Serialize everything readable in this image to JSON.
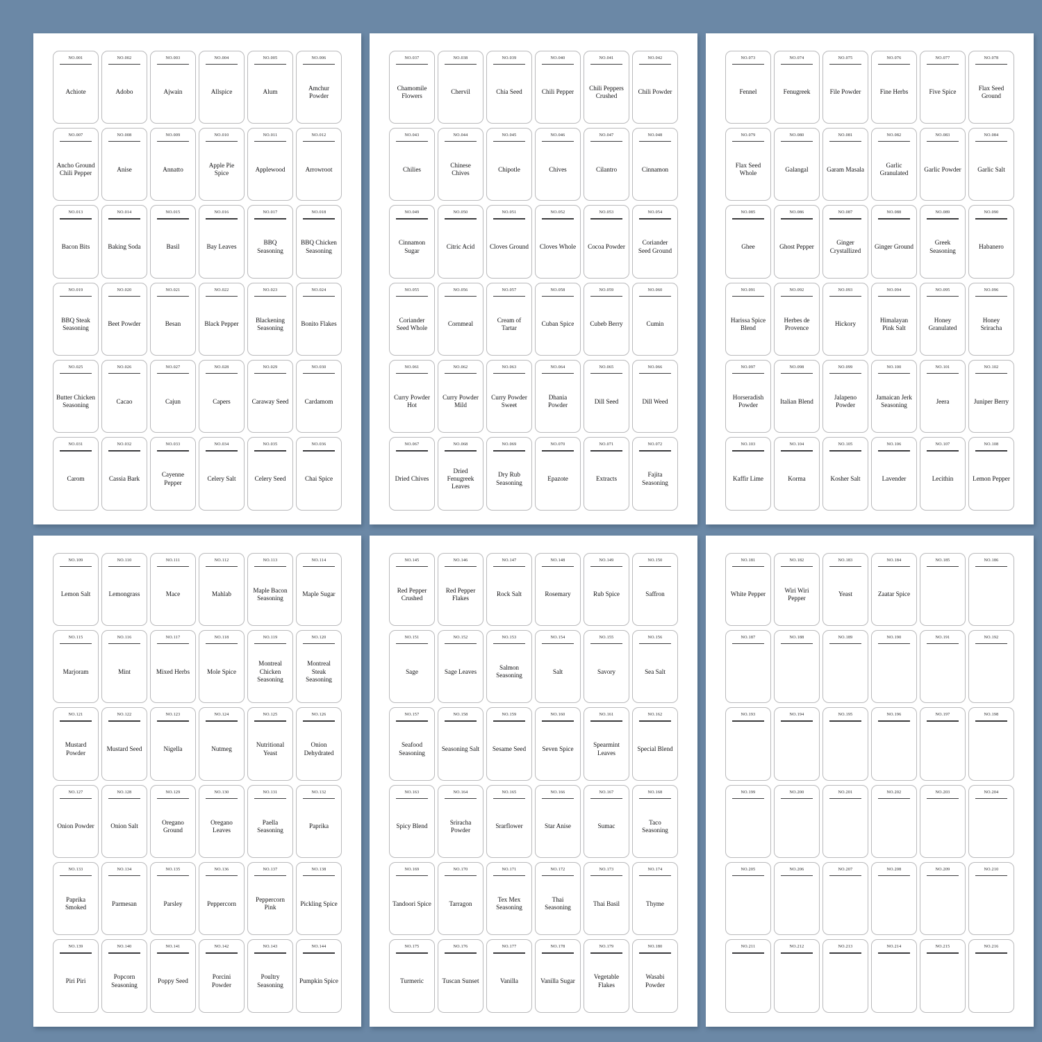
{
  "page": {
    "background_color": "#6b88a6",
    "sheet_color": "#ffffff",
    "card_border_color": "#b9b9bb",
    "rule_color": "#3a3a3c",
    "text_color": "#111113",
    "number_prefix": "NO.",
    "sheets_across": 3,
    "sheets_down": 2,
    "cards_per_sheet": 36,
    "cards_across": 6,
    "cards_down": 6,
    "total_cards": 216
  },
  "sheets": [
    {
      "id": "sheet-1",
      "cards": [
        {
          "no": "NO.001",
          "name": "Achiote"
        },
        {
          "no": "NO.002",
          "name": "Adobo"
        },
        {
          "no": "NO.003",
          "name": "Ajwain"
        },
        {
          "no": "NO.004",
          "name": "Allspice"
        },
        {
          "no": "NO.005",
          "name": "Alum"
        },
        {
          "no": "NO.006",
          "name": "Amchur Powder"
        },
        {
          "no": "NO.007",
          "name": "Ancho Ground Chili Pepper"
        },
        {
          "no": "NO.008",
          "name": "Anise"
        },
        {
          "no": "NO.009",
          "name": "Annatto"
        },
        {
          "no": "NO.010",
          "name": "Apple Pie Spice"
        },
        {
          "no": "NO.011",
          "name": "Applewood"
        },
        {
          "no": "NO.012",
          "name": "Arrowroot"
        },
        {
          "no": "NO.013",
          "name": "Bacon Bits"
        },
        {
          "no": "NO.014",
          "name": "Baking Soda"
        },
        {
          "no": "NO.015",
          "name": "Basil"
        },
        {
          "no": "NO.016",
          "name": "Bay Leaves"
        },
        {
          "no": "NO.017",
          "name": "BBQ Seasoning"
        },
        {
          "no": "NO.018",
          "name": "BBQ Chicken Seasoning"
        },
        {
          "no": "NO.019",
          "name": "BBQ Steak Seasoning"
        },
        {
          "no": "NO.020",
          "name": "Beet Powder"
        },
        {
          "no": "NO.021",
          "name": "Besan"
        },
        {
          "no": "NO.022",
          "name": "Black Pepper"
        },
        {
          "no": "NO.023",
          "name": "Blackening Seasoning"
        },
        {
          "no": "NO.024",
          "name": "Bonito Flakes"
        },
        {
          "no": "NO.025",
          "name": "Butter Chicken Seasoning"
        },
        {
          "no": "NO.026",
          "name": "Cacao"
        },
        {
          "no": "NO.027",
          "name": "Cajun"
        },
        {
          "no": "NO.028",
          "name": "Capers"
        },
        {
          "no": "NO.029",
          "name": "Caraway Seed"
        },
        {
          "no": "NO.030",
          "name": "Cardamom"
        },
        {
          "no": "NO.031",
          "name": "Carom"
        },
        {
          "no": "NO.032",
          "name": "Cassia Bark"
        },
        {
          "no": "NO.033",
          "name": "Cayenne Pepper"
        },
        {
          "no": "NO.034",
          "name": "Celery Salt"
        },
        {
          "no": "NO.035",
          "name": "Celery Seed"
        },
        {
          "no": "NO.036",
          "name": "Chai Spice"
        }
      ]
    },
    {
      "id": "sheet-2",
      "cards": [
        {
          "no": "NO.037",
          "name": "Chamomile Flowers"
        },
        {
          "no": "NO.038",
          "name": "Chervil"
        },
        {
          "no": "NO.039",
          "name": "Chia Seed"
        },
        {
          "no": "NO.040",
          "name": "Chili Pepper"
        },
        {
          "no": "NO.041",
          "name": "Chili Peppers Crushed"
        },
        {
          "no": "NO.042",
          "name": "Chili Powder"
        },
        {
          "no": "NO.043",
          "name": "Chilies"
        },
        {
          "no": "NO.044",
          "name": "Chinese Chives"
        },
        {
          "no": "NO.045",
          "name": "Chipotle"
        },
        {
          "no": "NO.046",
          "name": "Chives"
        },
        {
          "no": "NO.047",
          "name": "Cilantro"
        },
        {
          "no": "NO.048",
          "name": "Cinnamon"
        },
        {
          "no": "NO.049",
          "name": "Cinnamon Sugar"
        },
        {
          "no": "NO.050",
          "name": "Citric Acid"
        },
        {
          "no": "NO.051",
          "name": "Cloves Ground"
        },
        {
          "no": "NO.052",
          "name": "Cloves Whole"
        },
        {
          "no": "NO.053",
          "name": "Cocoa Powder"
        },
        {
          "no": "NO.054",
          "name": "Coriander Seed Ground"
        },
        {
          "no": "NO.055",
          "name": "Coriander Seed Whole"
        },
        {
          "no": "NO.056",
          "name": "Cornmeal"
        },
        {
          "no": "NO.057",
          "name": "Cream of Tartar"
        },
        {
          "no": "NO.058",
          "name": "Cuban Spice"
        },
        {
          "no": "NO.059",
          "name": "Cubeb Berry"
        },
        {
          "no": "NO.060",
          "name": "Cumin"
        },
        {
          "no": "NO.061",
          "name": "Curry Powder Hot"
        },
        {
          "no": "NO.062",
          "name": "Curry Powder Mild"
        },
        {
          "no": "NO.063",
          "name": "Curry Powder Sweet"
        },
        {
          "no": "NO.064",
          "name": "Dhania Powder"
        },
        {
          "no": "NO.065",
          "name": "Dill Seed"
        },
        {
          "no": "NO.066",
          "name": "Dill Weed"
        },
        {
          "no": "NO.067",
          "name": "Dried Chives"
        },
        {
          "no": "NO.068",
          "name": "Dried Fenugreek Leaves"
        },
        {
          "no": "NO.069",
          "name": "Dry Rub Seasoning"
        },
        {
          "no": "NO.070",
          "name": "Epazote"
        },
        {
          "no": "NO.071",
          "name": "Extracts"
        },
        {
          "no": "NO.072",
          "name": "Fajita Seasoning"
        }
      ]
    },
    {
      "id": "sheet-3",
      "cards": [
        {
          "no": "NO.073",
          "name": "Fennel"
        },
        {
          "no": "NO.074",
          "name": "Fenugreek"
        },
        {
          "no": "NO.075",
          "name": "File Powder"
        },
        {
          "no": "NO.076",
          "name": "Fine Herbs"
        },
        {
          "no": "NO.077",
          "name": "Five Spice"
        },
        {
          "no": "NO.078",
          "name": "Flax Seed Ground"
        },
        {
          "no": "NO.079",
          "name": "Flax Seed Whole"
        },
        {
          "no": "NO.080",
          "name": "Galangal"
        },
        {
          "no": "NO.081",
          "name": "Garam Masala"
        },
        {
          "no": "NO.082",
          "name": "Garlic Granulated"
        },
        {
          "no": "NO.083",
          "name": "Garlic Powder"
        },
        {
          "no": "NO.084",
          "name": "Garlic Salt"
        },
        {
          "no": "NO.085",
          "name": "Ghee"
        },
        {
          "no": "NO.086",
          "name": "Ghost Pepper"
        },
        {
          "no": "NO.087",
          "name": "Ginger Crystallized"
        },
        {
          "no": "NO.088",
          "name": "Ginger Ground"
        },
        {
          "no": "NO.089",
          "name": "Greek Seasoning"
        },
        {
          "no": "NO.090",
          "name": "Habanero"
        },
        {
          "no": "NO.091",
          "name": "Harissa Spice Blend"
        },
        {
          "no": "NO.092",
          "name": "Herbes de Provence"
        },
        {
          "no": "NO.093",
          "name": "Hickory"
        },
        {
          "no": "NO.094",
          "name": "Himalayan Pink Salt"
        },
        {
          "no": "NO.095",
          "name": "Honey Granulated"
        },
        {
          "no": "NO.096",
          "name": "Honey Sriracha"
        },
        {
          "no": "NO.097",
          "name": "Horseradish Powder"
        },
        {
          "no": "NO.098",
          "name": "Italian Blend"
        },
        {
          "no": "NO.099",
          "name": "Jalapeno Powder"
        },
        {
          "no": "NO.100",
          "name": "Jamaican Jerk Seasoning"
        },
        {
          "no": "NO.101",
          "name": "Jeera"
        },
        {
          "no": "NO.102",
          "name": "Juniper Berry"
        },
        {
          "no": "NO.103",
          "name": "Kaffir Lime"
        },
        {
          "no": "NO.104",
          "name": "Korma"
        },
        {
          "no": "NO.105",
          "name": "Kosher Salt"
        },
        {
          "no": "NO.106",
          "name": "Lavender"
        },
        {
          "no": "NO.107",
          "name": "Lecithin"
        },
        {
          "no": "NO.108",
          "name": "Lemon Pepper"
        }
      ]
    },
    {
      "id": "sheet-4",
      "cards": [
        {
          "no": "NO.109",
          "name": "Lemon Salt"
        },
        {
          "no": "NO.110",
          "name": "Lemongrass"
        },
        {
          "no": "NO.111",
          "name": "Mace"
        },
        {
          "no": "NO.112",
          "name": "Mahlab"
        },
        {
          "no": "NO.113",
          "name": "Maple Bacon Seasoning"
        },
        {
          "no": "NO.114",
          "name": "Maple Sugar"
        },
        {
          "no": "NO.115",
          "name": "Marjoram"
        },
        {
          "no": "NO.116",
          "name": "Mint"
        },
        {
          "no": "NO.117",
          "name": "Mixed Herbs"
        },
        {
          "no": "NO.118",
          "name": "Mole Spice"
        },
        {
          "no": "NO.119",
          "name": "Montreal Chicken Seasoning"
        },
        {
          "no": "NO.120",
          "name": "Montreal Steak Seasoning"
        },
        {
          "no": "NO.121",
          "name": "Mustard Powder"
        },
        {
          "no": "NO.122",
          "name": "Mustard Seed"
        },
        {
          "no": "NO.123",
          "name": "Nigella"
        },
        {
          "no": "NO.124",
          "name": "Nutmeg"
        },
        {
          "no": "NO.125",
          "name": "Nutritional Yeast"
        },
        {
          "no": "NO.126",
          "name": "Onion Dehydrated"
        },
        {
          "no": "NO.127",
          "name": "Onion Powder"
        },
        {
          "no": "NO.128",
          "name": "Onion Salt"
        },
        {
          "no": "NO.129",
          "name": "Oregano Ground"
        },
        {
          "no": "NO.130",
          "name": "Oregano Leaves"
        },
        {
          "no": "NO.131",
          "name": "Paella Seasoning"
        },
        {
          "no": "NO.132",
          "name": "Paprika"
        },
        {
          "no": "NO.133",
          "name": "Paprika Smoked"
        },
        {
          "no": "NO.134",
          "name": "Parmesan"
        },
        {
          "no": "NO.135",
          "name": "Parsley"
        },
        {
          "no": "NO.136",
          "name": "Peppercorn"
        },
        {
          "no": "NO.137",
          "name": "Peppercorn Pink"
        },
        {
          "no": "NO.138",
          "name": "Pickling Spice"
        },
        {
          "no": "NO.139",
          "name": "Piri Piri"
        },
        {
          "no": "NO.140",
          "name": "Popcorn Seasoning"
        },
        {
          "no": "NO.141",
          "name": "Poppy Seed"
        },
        {
          "no": "NO.142",
          "name": "Porcini Powder"
        },
        {
          "no": "NO.143",
          "name": "Poultry Seasoning"
        },
        {
          "no": "NO.144",
          "name": "Pumpkin Spice"
        }
      ]
    },
    {
      "id": "sheet-5",
      "cards": [
        {
          "no": "NO.145",
          "name": "Red Pepper Crushed"
        },
        {
          "no": "NO.146",
          "name": "Red Pepper Flakes"
        },
        {
          "no": "NO.147",
          "name": "Rock Salt"
        },
        {
          "no": "NO.148",
          "name": "Rosemary"
        },
        {
          "no": "NO.149",
          "name": "Rub Spice"
        },
        {
          "no": "NO.150",
          "name": "Saffron"
        },
        {
          "no": "NO.151",
          "name": "Sage"
        },
        {
          "no": "NO.152",
          "name": "Sage Leaves"
        },
        {
          "no": "NO.153",
          "name": "Salmon Seasoning"
        },
        {
          "no": "NO.154",
          "name": "Salt"
        },
        {
          "no": "NO.155",
          "name": "Savory"
        },
        {
          "no": "NO.156",
          "name": "Sea Salt"
        },
        {
          "no": "NO.157",
          "name": "Seafood Seasoning"
        },
        {
          "no": "NO.158",
          "name": "Seasoning Salt"
        },
        {
          "no": "NO.159",
          "name": "Sesame Seed"
        },
        {
          "no": "NO.160",
          "name": "Seven Spice"
        },
        {
          "no": "NO.161",
          "name": "Spearmint Leaves"
        },
        {
          "no": "NO.162",
          "name": "Special Blend"
        },
        {
          "no": "NO.163",
          "name": "Spicy Blend"
        },
        {
          "no": "NO.164",
          "name": "Sriracha Powder"
        },
        {
          "no": "NO.165",
          "name": "Srarflower"
        },
        {
          "no": "NO.166",
          "name": "Star Anise"
        },
        {
          "no": "NO.167",
          "name": "Sumac"
        },
        {
          "no": "NO.168",
          "name": "Taco Seasoning"
        },
        {
          "no": "NO.169",
          "name": "Tandoori Spice"
        },
        {
          "no": "NO.170",
          "name": "Tarragon"
        },
        {
          "no": "NO.171",
          "name": "Tex Mex Seasoning"
        },
        {
          "no": "NO.172",
          "name": "Thai Seasoning"
        },
        {
          "no": "NO.173",
          "name": "Thai Basil"
        },
        {
          "no": "NO.174",
          "name": "Thyme"
        },
        {
          "no": "NO.175",
          "name": "Turmeric"
        },
        {
          "no": "NO.176",
          "name": "Tuscan Sunset"
        },
        {
          "no": "NO.177",
          "name": "Vanilla"
        },
        {
          "no": "NO.178",
          "name": "Vanilla Sugar"
        },
        {
          "no": "NO.179",
          "name": "Vegetable Flakes"
        },
        {
          "no": "NO.180",
          "name": "Wasabi Powder"
        }
      ]
    },
    {
      "id": "sheet-6",
      "cards": [
        {
          "no": "NO.181",
          "name": "White Pepper"
        },
        {
          "no": "NO.182",
          "name": "Wiri Wiri Pepper"
        },
        {
          "no": "NO.183",
          "name": "Yeast"
        },
        {
          "no": "NO.184",
          "name": "Zaatar Spice"
        },
        {
          "no": "NO.185",
          "name": ""
        },
        {
          "no": "NO.186",
          "name": ""
        },
        {
          "no": "NO.187",
          "name": ""
        },
        {
          "no": "NO.188",
          "name": ""
        },
        {
          "no": "NO.189",
          "name": ""
        },
        {
          "no": "NO.190",
          "name": ""
        },
        {
          "no": "NO.191",
          "name": ""
        },
        {
          "no": "NO.192",
          "name": ""
        },
        {
          "no": "NO.193",
          "name": ""
        },
        {
          "no": "NO.194",
          "name": ""
        },
        {
          "no": "NO.195",
          "name": ""
        },
        {
          "no": "NO.196",
          "name": ""
        },
        {
          "no": "NO.197",
          "name": ""
        },
        {
          "no": "NO.198",
          "name": ""
        },
        {
          "no": "NO.199",
          "name": ""
        },
        {
          "no": "NO.200",
          "name": ""
        },
        {
          "no": "NO.201",
          "name": ""
        },
        {
          "no": "NO.202",
          "name": ""
        },
        {
          "no": "NO.203",
          "name": ""
        },
        {
          "no": "NO.204",
          "name": ""
        },
        {
          "no": "NO.205",
          "name": ""
        },
        {
          "no": "NO.206",
          "name": ""
        },
        {
          "no": "NO.207",
          "name": ""
        },
        {
          "no": "NO.208",
          "name": ""
        },
        {
          "no": "NO.209",
          "name": ""
        },
        {
          "no": "NO.210",
          "name": ""
        },
        {
          "no": "NO.211",
          "name": ""
        },
        {
          "no": "NO.212",
          "name": ""
        },
        {
          "no": "NO.213",
          "name": ""
        },
        {
          "no": "NO.214",
          "name": ""
        },
        {
          "no": "NO.215",
          "name": ""
        },
        {
          "no": "NO.216",
          "name": ""
        }
      ]
    }
  ]
}
